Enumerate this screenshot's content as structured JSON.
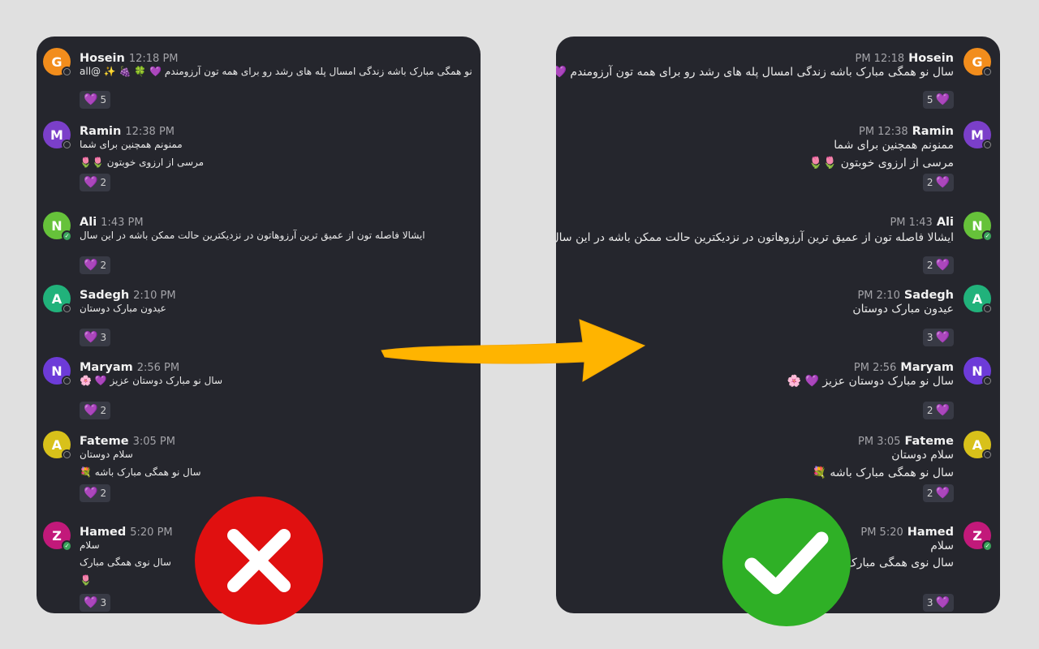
{
  "left": {
    "messages": [
      {
        "initial": "G",
        "color": "#f28d1c",
        "status": "offline",
        "name": "Hosein",
        "time": "12:18 PM",
        "lines": [
          "نو همگی مبارک باشه زندگی امسال پله های رشد رو برای همه تون آرزومندم 💜 🍀 🍇 ✨ @all"
        ],
        "reaction": "5"
      },
      {
        "initial": "M",
        "color": "#7b3fc9",
        "status": "offline",
        "name": "Ramin",
        "time": "12:38 PM",
        "lines": [
          "ممنونم همچنین برای شما",
          "مرسی از ارزوی خوبتون 🌷🌷"
        ],
        "reaction": "2"
      },
      {
        "initial": "N",
        "color": "#66c23a",
        "status": "online",
        "name": "Ali",
        "time": "1:43 PM",
        "lines": [
          "ایشالا فاصله تون از عمیق ترین آرزوهاتون در نزدیکترین حالت ممکن باشه در این سال"
        ],
        "reaction": "2"
      },
      {
        "initial": "A",
        "color": "#21b27b",
        "status": "offline",
        "name": "Sadegh",
        "time": "2:10 PM",
        "lines": [
          "عیدون مبارک دوستان"
        ],
        "reaction": "3"
      },
      {
        "initial": "N",
        "color": "#6d3bd8",
        "status": "offline",
        "name": "Maryam",
        "time": "2:56 PM",
        "lines": [
          "سال نو مبارک دوستان عزیز 💜 🌸"
        ],
        "reaction": "2"
      },
      {
        "initial": "A",
        "color": "#d8c11a",
        "status": "offline",
        "name": "Fateme",
        "time": "3:05 PM",
        "lines": [
          "سلام دوستان",
          "سال نو همگی مبارک باشه 💐"
        ],
        "reaction": "2"
      },
      {
        "initial": "Z",
        "color": "#c2197a",
        "status": "online",
        "name": "Hamed",
        "time": "5:20 PM",
        "lines": [
          "سلام",
          "سال نوی همگی مبارک",
          "🌷"
        ],
        "reaction": "3"
      }
    ]
  },
  "right": {
    "messages": [
      {
        "initial": "G",
        "color": "#f28d1c",
        "status": "offline",
        "name": "Hosein",
        "time": "PM 12:18",
        "lines": [
          "سال نو همگی مبارک باشه زندگی امسال پله های رشد رو برای همه تون آرزومندم 💜 🍇"
        ],
        "reaction": "5"
      },
      {
        "initial": "M",
        "color": "#7b3fc9",
        "status": "offline",
        "name": "Ramin",
        "time": "PM 12:38",
        "lines": [
          "ممنونم همچنین برای شما",
          "مرسی از ارزوی خوبتون 🌷🌷"
        ],
        "reaction": "2"
      },
      {
        "initial": "N",
        "color": "#66c23a",
        "status": "online",
        "name": "Ali",
        "time": "PM 1:43",
        "lines": [
          "ایشالا فاصله تون از عمیق ترین آرزوهاتون در نزدیکترین حالت ممکن باشه در این سال"
        ],
        "reaction": "2"
      },
      {
        "initial": "A",
        "color": "#21b27b",
        "status": "offline",
        "name": "Sadegh",
        "time": "PM 2:10",
        "lines": [
          "عیدون مبارک دوستان"
        ],
        "reaction": "3"
      },
      {
        "initial": "N",
        "color": "#6d3bd8",
        "status": "offline",
        "name": "Maryam",
        "time": "PM 2:56",
        "lines": [
          "سال نو مبارک دوستان عزیز 💜 🌸"
        ],
        "reaction": "2"
      },
      {
        "initial": "A",
        "color": "#d8c11a",
        "status": "offline",
        "name": "Fateme",
        "time": "PM 3:05",
        "lines": [
          "سلام دوستان",
          "سال نو همگی مبارک باشه 💐"
        ],
        "reaction": "2"
      },
      {
        "initial": "Z",
        "color": "#c2197a",
        "status": "online",
        "name": "Hamed",
        "time": "PM 5:20",
        "lines": [
          "سلام",
          "سال نوی همگی مبارک"
        ],
        "reaction": "3"
      }
    ]
  },
  "colors": {
    "arrow": "#ffb400",
    "bad": "#e01010",
    "good": "#2fb026",
    "heart": "#a055ff"
  },
  "icons": {
    "bad": "x-mark-icon",
    "good": "check-mark-icon",
    "arrow": "right-arrow-icon",
    "reaction": "purple-heart-icon"
  }
}
